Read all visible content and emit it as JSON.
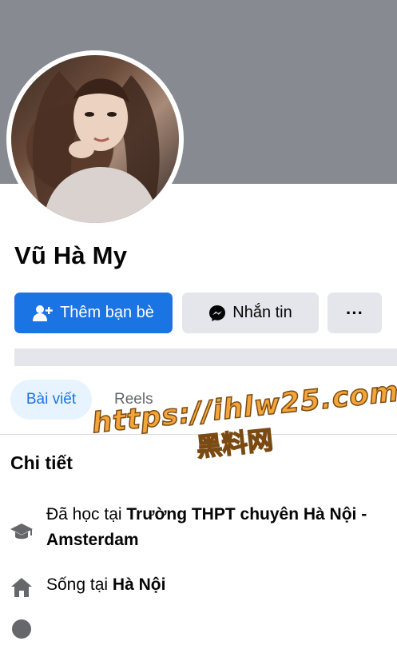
{
  "profile": {
    "name": "Vũ Hà My"
  },
  "actions": {
    "add_friend_label": "Thêm bạn bè",
    "message_label": "Nhắn tin",
    "more_label": "···"
  },
  "tabs": [
    {
      "label": "Bài viết",
      "active": true
    },
    {
      "label": "Reels",
      "active": false
    }
  ],
  "details": {
    "title": "Chi tiết",
    "education": {
      "prefix": "Đã học tại ",
      "school": "Trường THPT chuyên Hà Nội - Amsterdam",
      "icon": "graduation-cap-icon"
    },
    "lives": {
      "prefix": "Sống tại ",
      "place": "Hà Nội",
      "icon": "house-icon"
    }
  },
  "watermark": {
    "url": "https://ihlw25.com",
    "text": "黑料网"
  },
  "colors": {
    "cover": "#878a91",
    "primary": "#1b74e4",
    "secondary_button": "#e4e6eb",
    "active_tab_bg": "#e7f3ff",
    "watermark": "#f4a53a"
  }
}
